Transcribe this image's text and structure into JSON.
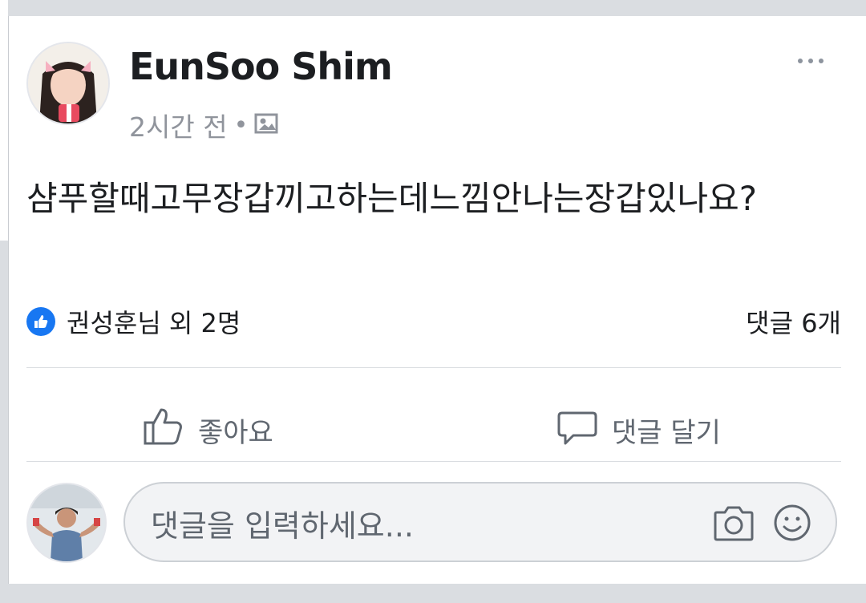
{
  "post": {
    "author": "EunSoo Shim",
    "time": "2시간 전",
    "separator": "•",
    "privacy_icon": "photo-album-icon",
    "text": "샴푸할때고무장갑끼고하는데느낌안나는장갑있나요?"
  },
  "reactions": {
    "summary": "권성훈님 외 2명",
    "comment_count": "댓글 6개"
  },
  "actions": {
    "like_label": "좋아요",
    "comment_label": "댓글 달기"
  },
  "composer": {
    "placeholder": "댓글을 입력하세요..."
  },
  "icons": {
    "more": "more-horizontal-icon",
    "like": "thumbs-up-icon",
    "comment": "speech-bubble-icon",
    "camera": "camera-icon",
    "emoji": "smiley-icon"
  },
  "colors": {
    "like_badge": "#1877f2",
    "secondary_text": "#90949c"
  }
}
